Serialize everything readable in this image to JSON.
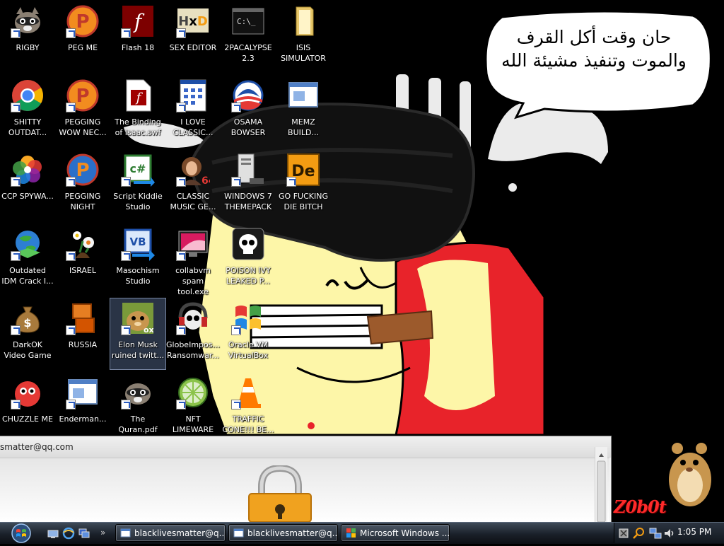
{
  "desktop": {
    "icons": [
      {
        "label": "RIGBY",
        "icon": "raccoon-icon"
      },
      {
        "label": "PEG ME",
        "icon": "peggle-icon"
      },
      {
        "label": "Flash 18",
        "icon": "flash-icon"
      },
      {
        "label": "SEX EDITOR",
        "icon": "hxd-icon"
      },
      {
        "label": "2PACALYPSE 2.3",
        "icon": "terminal-icon"
      },
      {
        "label": "ISIS SIMULATOR",
        "icon": "folder-icon"
      },
      {
        "label": "SHITTY OUTDAT...",
        "icon": "chrome-icon"
      },
      {
        "label": "PEGGING WOW NEC...",
        "icon": "peggle-icon"
      },
      {
        "label": "The Binding of Isaac.swf",
        "icon": "flash-file-icon"
      },
      {
        "label": "I LOVE CLASSIC...",
        "icon": "calculator-window-icon"
      },
      {
        "label": "OSAMA BOWSER",
        "icon": "obama-logo-icon"
      },
      {
        "label": "MEMZ BUILD...",
        "icon": "window-icon"
      },
      {
        "label": "CCP SPYWA...",
        "icon": "photos-pinwheel-icon"
      },
      {
        "label": "PEGGING NIGHT",
        "icon": "peggle-icon"
      },
      {
        "label": "Script Kiddie Studio",
        "icon": "csharp-icon"
      },
      {
        "label": "CLASSIC MUSIC GE...",
        "icon": "portrait-64-icon"
      },
      {
        "label": "WINDOWS 7 THEMEPACK",
        "icon": "server-icon"
      },
      {
        "label": "GO FUCKING DIE BITCH",
        "icon": "de-icon"
      },
      {
        "label": "Outdated IDM Crack I...",
        "icon": "idm-globe-icon"
      },
      {
        "label": "ISRAEL",
        "icon": "flower-icon"
      },
      {
        "label": "Masochism Studio",
        "icon": "vb-icon"
      },
      {
        "label": "collabvm spam tool.exe",
        "icon": "monitor-icon"
      },
      {
        "label": "POISON IVY LEAKED P...",
        "icon": "skull-icon"
      },
      {
        "label": "DarkOK Video Game",
        "icon": "money-bag-icon"
      },
      {
        "label": "RUSSIA",
        "icon": "orange-blocks-icon"
      },
      {
        "label": "Elon Musk ruined twitt...",
        "icon": "hamster-box-icon"
      },
      {
        "label": "GlobeImpos... Ransomwar...",
        "icon": "skull-headphones-icon"
      },
      {
        "label": "Oracle VM VirtualBox",
        "icon": "windows-flag-icon"
      },
      {
        "label": "CHUZZLE ME",
        "icon": "chuzzle-icon"
      },
      {
        "label": "Enderman...",
        "icon": "window-icon"
      },
      {
        "label": "The Quran.pdf",
        "icon": "raccoon-icon"
      },
      {
        "label": "NFT LIMEWARE",
        "icon": "limewire-icon"
      },
      {
        "label": "TRAFFIC CONE!!! BE...",
        "icon": "traffic-cone-icon"
      }
    ],
    "speech_bubble": {
      "line1": "حان وقت أكل القرف",
      "line2": "والموت وتنفيذ مشيئة الله"
    },
    "corner_text": "Z0b0t"
  },
  "dialog": {
    "title": "smatter@qq.com"
  },
  "taskbar": {
    "tasks": [
      {
        "label": "blacklivesmatter@q..."
      },
      {
        "label": "blacklivesmatter@q..."
      },
      {
        "label": "Microsoft Windows ..."
      }
    ],
    "clock": "1:05 PM"
  }
}
